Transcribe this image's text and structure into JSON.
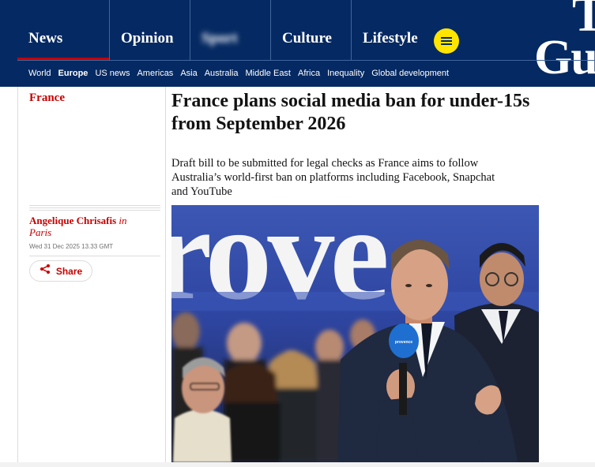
{
  "nav": {
    "pillars": [
      {
        "id": "news",
        "label": "News",
        "active": true
      },
      {
        "id": "opinion",
        "label": "Opinion"
      },
      {
        "id": "sport",
        "label": "Sport",
        "obscured": true
      },
      {
        "id": "culture",
        "label": "Culture"
      },
      {
        "id": "lifestyle",
        "label": "Lifestyle"
      }
    ],
    "menu_icon": "hamburger-menu-icon",
    "logo_line1": "T",
    "logo_line2": "Gu",
    "subnav": [
      "World",
      "Europe",
      "US news",
      "Americas",
      "Asia",
      "Australia",
      "Middle East",
      "Africa",
      "Inequality",
      "Global development"
    ],
    "subnav_active": "Europe"
  },
  "article": {
    "section": "France",
    "headline": "France plans social media ban for under-15s from September 2026",
    "standfirst": "Draft bill to be submitted for legal checks as France aims to follow Australia’s world-first ban on platforms including Facebook, Snapchat and YouTube",
    "author": "Angelique Chrisafis",
    "location_prefix": "in",
    "location": "Paris",
    "dateline": "Wed 31 Dec 2025 13.33 GMT",
    "share_label": "Share",
    "share_icon": "share-icon",
    "photo": {
      "backdrop_text": "rove",
      "mic_text": "provence"
    }
  },
  "colors": {
    "brand_navy": "#052962",
    "news_red": "#c70000",
    "menu_yellow": "#ffe500",
    "divider": "#41669d"
  }
}
